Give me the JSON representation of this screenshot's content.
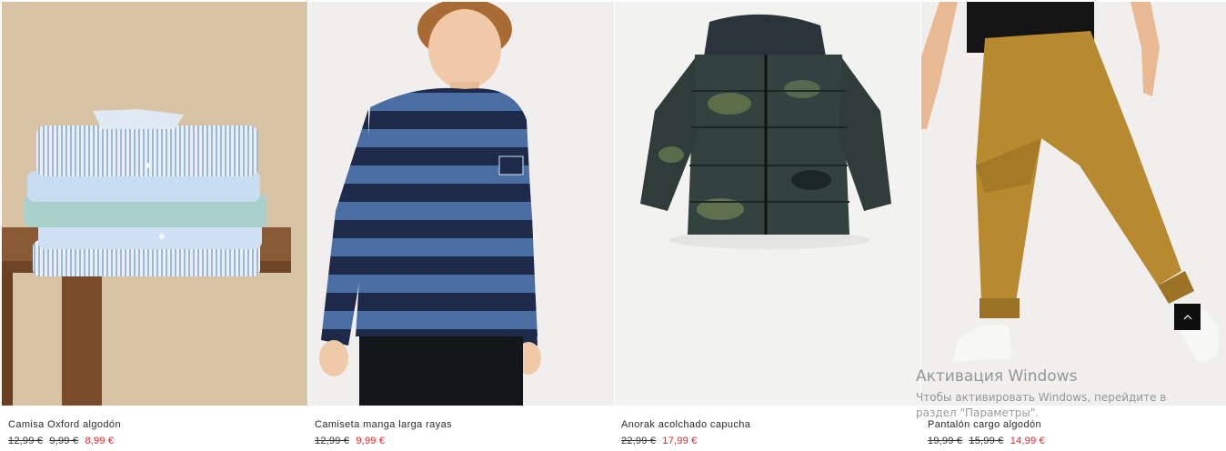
{
  "products": [
    {
      "name": "Camisa Oxford algodón",
      "prices": {
        "old1": "12,99 €",
        "old2": "9,99 €",
        "current": "8,99 €"
      },
      "image": "folded-striped-shirts-on-stool"
    },
    {
      "name": "Camiseta manga larga rayas",
      "prices": {
        "old1": "12,99 €",
        "current": "9,99 €"
      },
      "image": "boy-in-navy-blue-striped-tee"
    },
    {
      "name": "Anorak acolchado capucha",
      "prices": {
        "old1": "22,99 €",
        "current": "17,99 €"
      },
      "image": "camo-puffer-hooded-jacket"
    },
    {
      "name": "Pantalón cargo algodón",
      "prices": {
        "old1": "19,99 €",
        "old2": "15,99 €",
        "current": "14,99 €"
      },
      "image": "mustard-cargo-joggers"
    }
  ],
  "scroll_top": {
    "icon": "chevron-up-icon"
  },
  "watermark": {
    "title": "Активация Windows",
    "text": "Чтобы активировать Windows, перейдите в раздел \"Параметры\"."
  },
  "colors": {
    "sale_price": "#e0262b",
    "scroll_button_bg": "#0f0f0f"
  }
}
